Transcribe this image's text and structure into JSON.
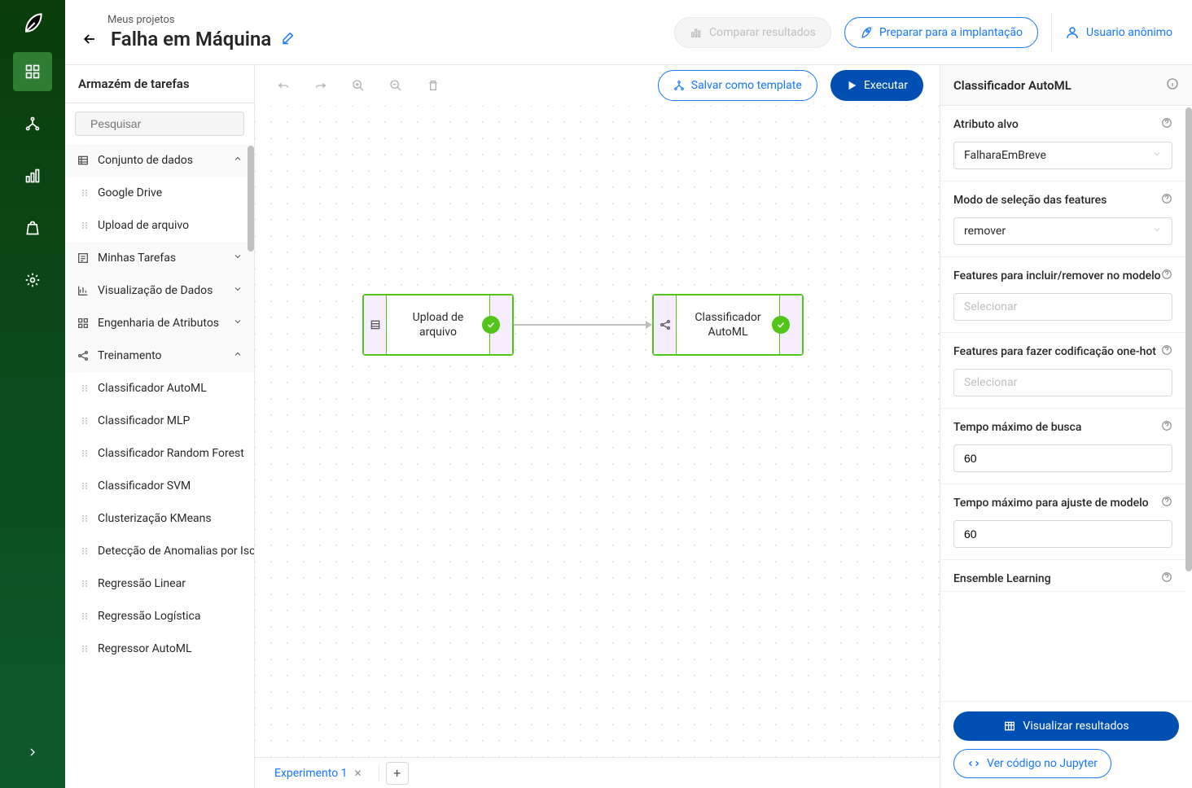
{
  "breadcrumb": "Meus projetos",
  "pageTitle": "Falha em Máquina",
  "headerButtons": {
    "compare": "Comparar resultados",
    "deploy": "Preparar para a implantação",
    "user": "Usuario anônimo"
  },
  "sidebar": {
    "title": "Armazém de tarefas",
    "searchPlaceholder": "Pesquisar",
    "categories": {
      "dataset": "Conjunto de dados",
      "myTasks": "Minhas Tarefas",
      "viz": "Visualização de Dados",
      "featEng": "Engenharia de Atributos",
      "training": "Treinamento"
    },
    "datasetItems": [
      "Google Drive",
      "Upload de arquivo"
    ],
    "trainingItems": [
      "Classificador AutoML",
      "Classificador MLP",
      "Classificador Random Forest",
      "Classificador SVM",
      "Clusterização KMeans",
      "Detecção de Anomalias por Isolation Forest",
      "Regressão Linear",
      "Regressão Logística",
      "Regressor AutoML"
    ]
  },
  "toolbar": {
    "saveTemplate": "Salvar como template",
    "execute": "Executar"
  },
  "canvas": {
    "node1": "Upload de arquivo",
    "node2": "Classificador AutoML"
  },
  "tabs": {
    "tab1": "Experimento 1"
  },
  "rightPanel": {
    "title": "Classificador AutoML",
    "fields": {
      "target": {
        "label": "Atributo alvo",
        "value": "FalharaEmBreve"
      },
      "featMode": {
        "label": "Modo de seleção das features",
        "value": "remover"
      },
      "featInclude": {
        "label": "Features para incluir/remover no modelo",
        "placeholder": "Selecionar"
      },
      "oneHot": {
        "label": "Features para fazer codificação one-hot",
        "placeholder": "Selecionar"
      },
      "searchTime": {
        "label": "Tempo máximo de busca",
        "value": "60"
      },
      "fitTime": {
        "label": "Tempo máximo para ajuste de modelo",
        "value": "60"
      },
      "ensemble": {
        "label": "Ensemble Learning"
      }
    },
    "footer": {
      "viewResults": "Visualizar resultados",
      "viewJupyter": "Ver código no Jupyter"
    }
  }
}
